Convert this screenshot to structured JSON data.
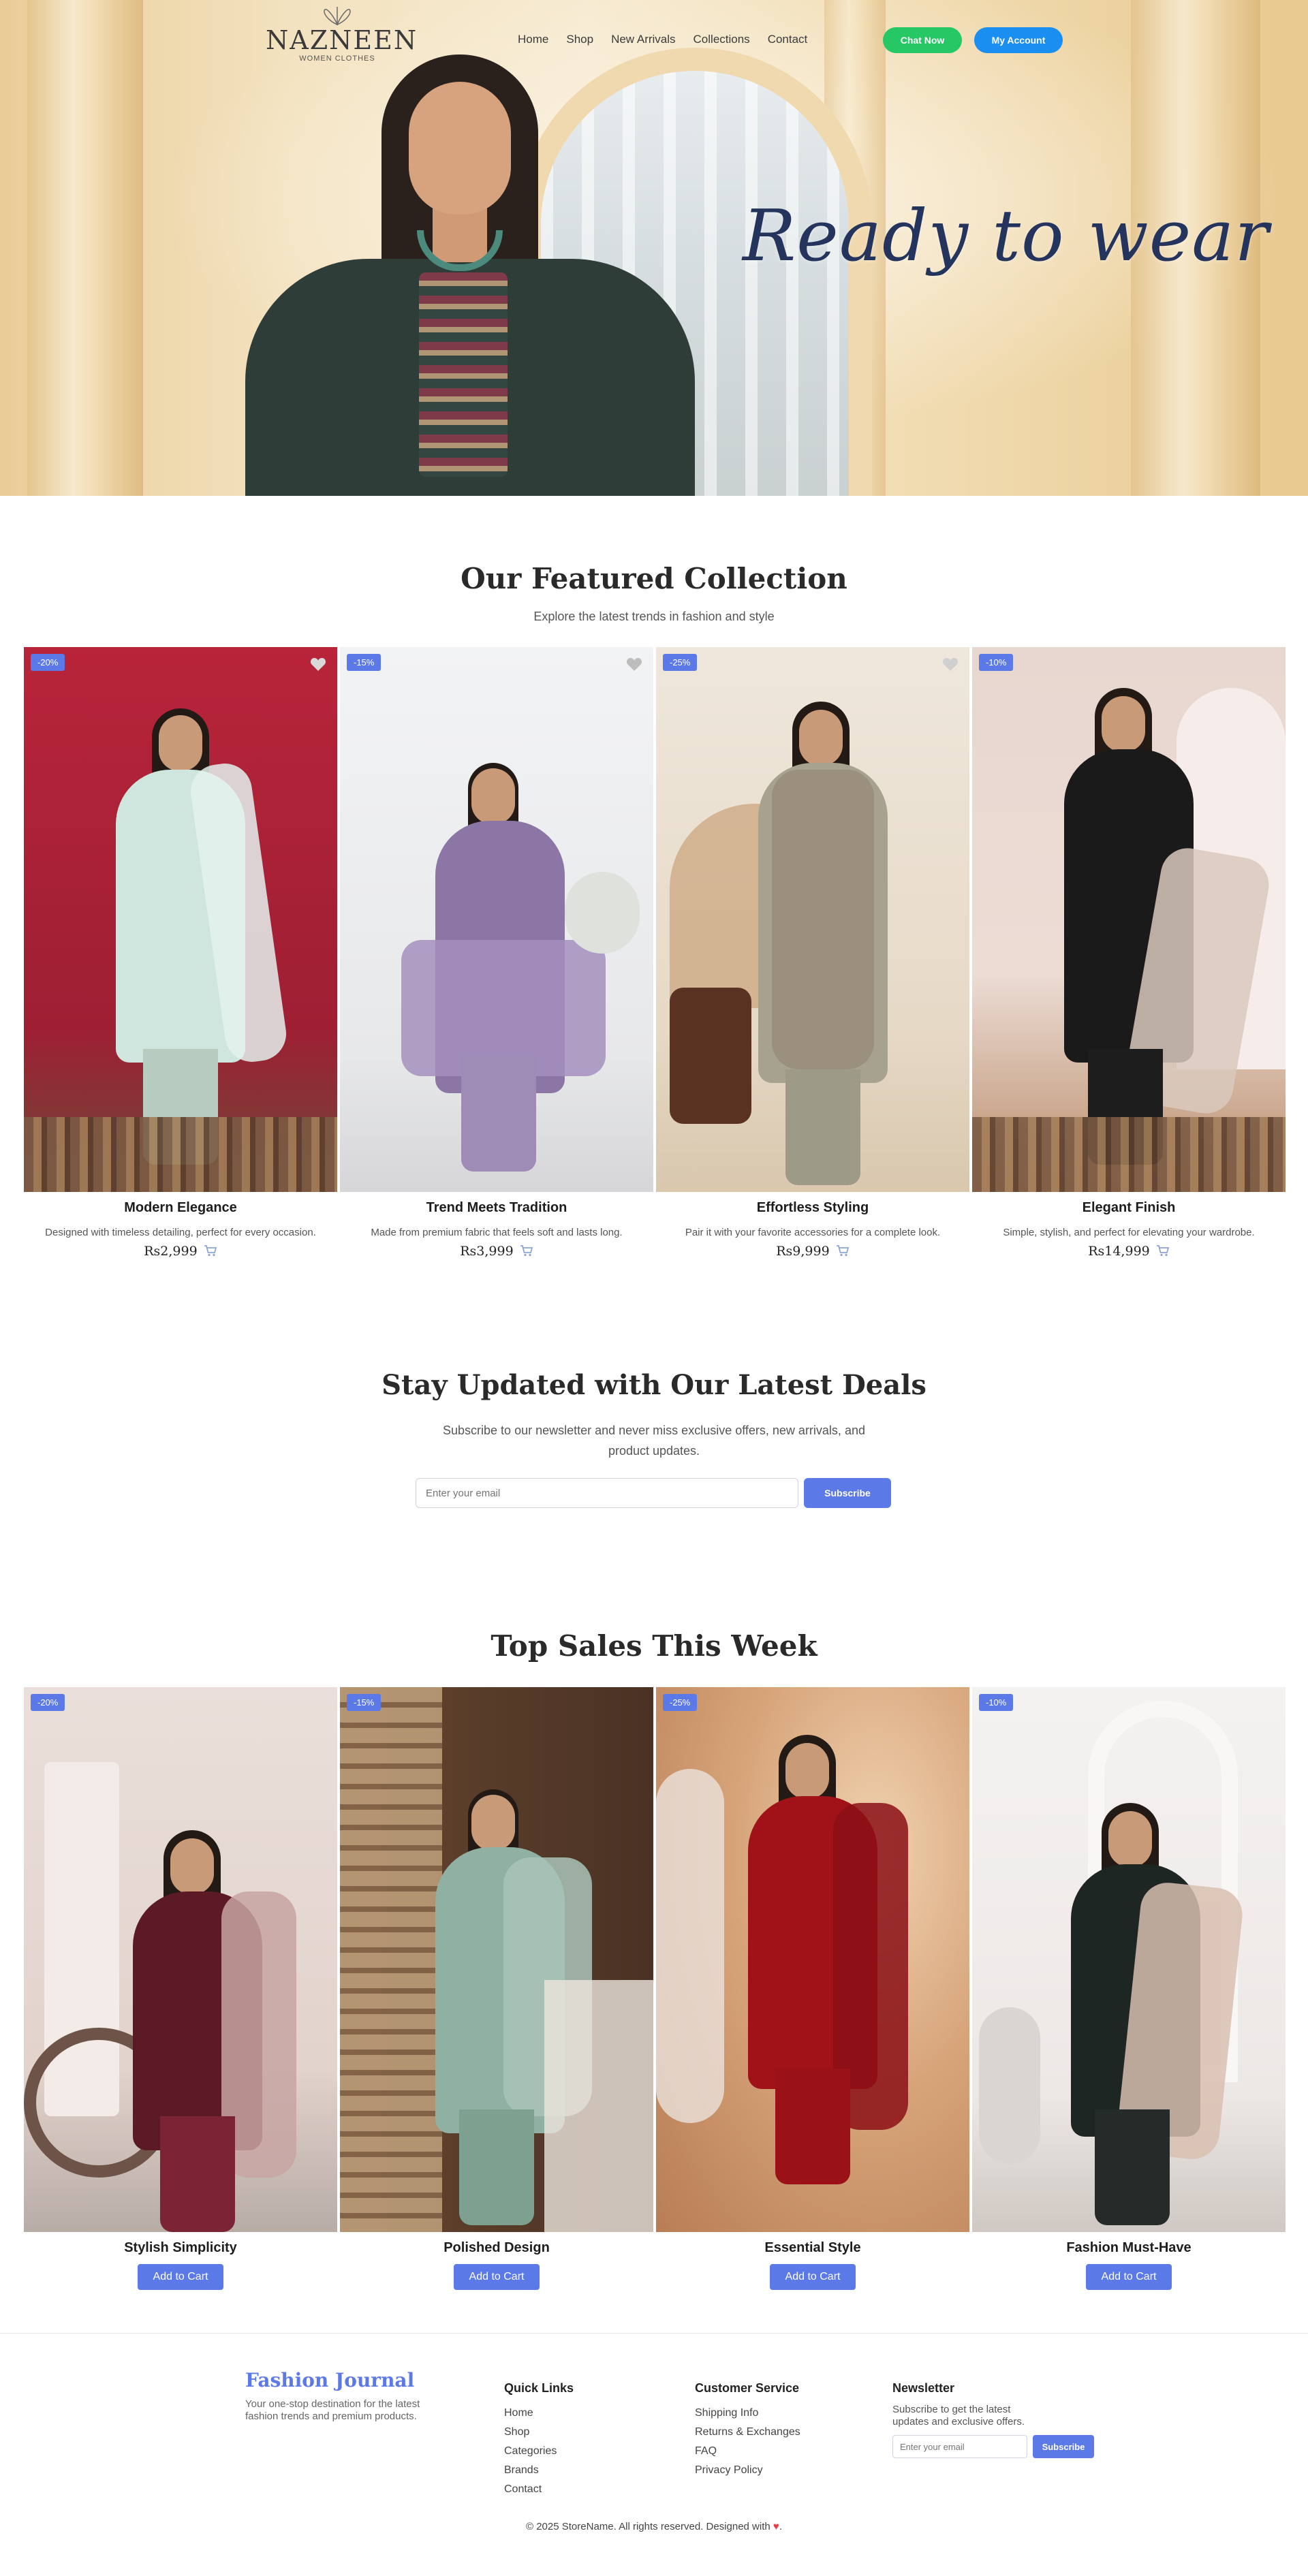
{
  "nav": {
    "logo_name": "NAZNEEN",
    "logo_sub": "WOMEN CLOTHES",
    "links": [
      "Home",
      "Shop",
      "New Arrivals",
      "Collections",
      "Contact"
    ],
    "chat_label": "Chat Now",
    "account_label": "My Account"
  },
  "hero": {
    "tagline": "Ready to wear"
  },
  "featured": {
    "title": "Our Featured Collection",
    "subtitle": "Explore the latest trends in fashion and style",
    "products": [
      {
        "badge": "-20%",
        "name": "Modern Elegance",
        "desc": "Designed with timeless detailing, perfect for every occasion.",
        "price": "Rs2,999"
      },
      {
        "badge": "-15%",
        "name": "Trend Meets Tradition",
        "desc": "Made from premium fabric that feels soft and lasts long.",
        "price": "Rs3,999"
      },
      {
        "badge": "-25%",
        "name": "Effortless Styling",
        "desc": "Pair it with your favorite accessories for a complete look.",
        "price": "Rs9,999"
      },
      {
        "badge": "-10%",
        "name": "Elegant Finish",
        "desc": "Simple, stylish, and perfect for elevating your wardrobe.",
        "price": "Rs14,999"
      }
    ]
  },
  "newsletter": {
    "title": "Stay Updated with Our Latest Deals",
    "subtitle": "Subscribe to our newsletter and never miss exclusive offers, new arrivals, and product updates.",
    "placeholder": "Enter your email",
    "button": "Subscribe"
  },
  "top_sales": {
    "title": "Top Sales This Week",
    "add_label": "Add to Cart",
    "products": [
      {
        "badge": "-20%",
        "name": "Stylish Simplicity"
      },
      {
        "badge": "-15%",
        "name": "Polished Design"
      },
      {
        "badge": "-25%",
        "name": "Essential Style"
      },
      {
        "badge": "-10%",
        "name": "Fashion Must-Have"
      }
    ]
  },
  "footer": {
    "brand_title": "Fashion Journal",
    "brand_text": "Your one-stop destination for the latest fashion trends and premium products.",
    "quick_links_title": "Quick Links",
    "quick_links": [
      "Home",
      "Shop",
      "Categories",
      "Brands",
      "Contact"
    ],
    "customer_service_title": "Customer Service",
    "customer_service": [
      "Shipping Info",
      "Returns & Exchanges",
      "FAQ",
      "Privacy Policy"
    ],
    "newsletter_title": "Newsletter",
    "newsletter_text": "Subscribe to get the latest updates and exclusive offers.",
    "newsletter_placeholder": "Enter your email",
    "newsletter_button": "Subscribe",
    "copyright": "© 2025 StoreName. All rights reserved. Designed with",
    "copyright_end": "."
  },
  "colors": {
    "accent": "#5c79e8",
    "chat": "#25c864",
    "account": "#1a8ef1",
    "heart": "#e23b4a"
  },
  "icons": [
    "heart-icon",
    "cart-icon",
    "logo-butterfly-icon"
  ]
}
